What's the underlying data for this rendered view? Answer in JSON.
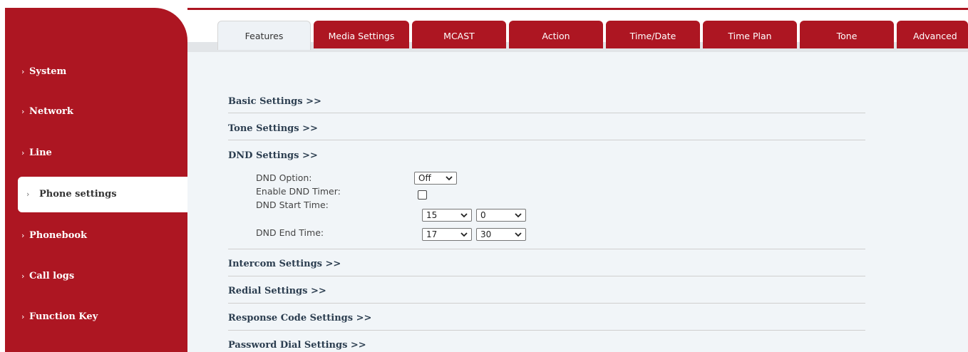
{
  "sidebar": {
    "items": [
      {
        "label": "System"
      },
      {
        "label": "Network"
      },
      {
        "label": "Line"
      },
      {
        "label": "Phone settings"
      },
      {
        "label": "Phonebook"
      },
      {
        "label": "Call logs"
      },
      {
        "label": "Function Key"
      }
    ],
    "active": "Phone settings"
  },
  "tabs": [
    {
      "label": "Features"
    },
    {
      "label": "Media Settings"
    },
    {
      "label": "MCAST"
    },
    {
      "label": "Action"
    },
    {
      "label": "Time/Date"
    },
    {
      "label": "Time Plan"
    },
    {
      "label": "Tone"
    },
    {
      "label": "Advanced"
    }
  ],
  "sections": {
    "basic": "Basic Settings >>",
    "tone": "Tone Settings >>",
    "dnd": "DND Settings >>",
    "intercom": "Intercom Settings >>",
    "redial": "Redial Settings >>",
    "response_code": "Response Code Settings >>",
    "password_dial": "Password Dial Settings >>"
  },
  "dnd": {
    "option_label": "DND Option:",
    "option_value": "Off",
    "timer_label": "Enable DND Timer:",
    "timer_enabled": false,
    "start_label": "DND Start Time:",
    "start_hour": "15",
    "start_minute": "0",
    "end_label": "DND End Time:",
    "end_hour": "17",
    "end_minute": "30"
  },
  "colors": {
    "brand_red": "#ad1622",
    "content_bg": "#f1f5f8"
  }
}
